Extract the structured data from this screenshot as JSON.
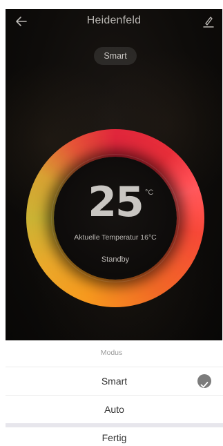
{
  "header": {
    "title": "Heidenfeld"
  },
  "mode_badge": "Smart",
  "thermostat": {
    "set_temperature": "25",
    "unit": "°C",
    "current_temperature_text": "Aktuelle Temperatur 16°C",
    "status": "Standby"
  },
  "sheet": {
    "title": "Modus",
    "options": [
      {
        "label": "Smart",
        "selected": true
      },
      {
        "label": "Auto",
        "selected": false
      }
    ],
    "done_label": "Fertig"
  },
  "icons": {
    "back": "arrow-left-icon",
    "edit": "pencil-icon",
    "check": "checkmark-circle-icon"
  },
  "colors": {
    "accent_red": "#e0303a",
    "accent_orange": "#f39a24",
    "accent_yellow": "#c9b33a",
    "check_grey": "#7c7c7c"
  }
}
